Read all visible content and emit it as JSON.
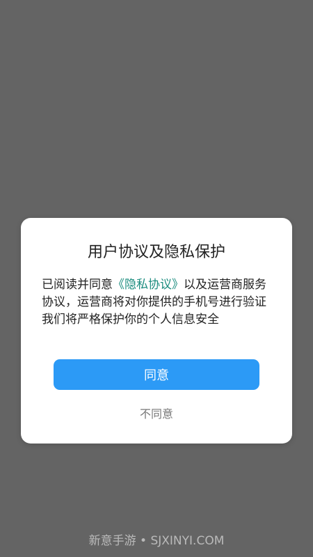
{
  "dialog": {
    "title": "用户协议及隐私保护",
    "body_prefix": "已阅读并同意",
    "policy_link": "《隐私协议》",
    "body_suffix": "以及运营商服务协议，运营商将对你提供的手机号进行验证",
    "body_line2": "我们将严格保护你的个人信息安全",
    "agree_label": "同意",
    "disagree_label": "不同意"
  },
  "watermark": {
    "text": "新意手游 • SJXINYI.COM"
  },
  "colors": {
    "overlay": "#646464",
    "accent": "#2c9af6",
    "link": "#1b8c7e"
  }
}
